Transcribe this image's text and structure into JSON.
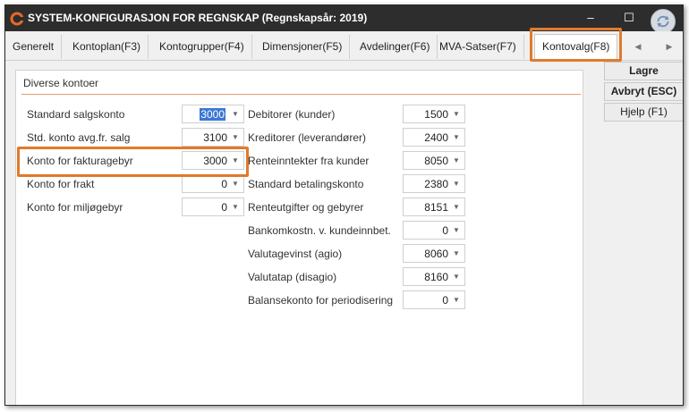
{
  "window": {
    "title": "SYSTEM-KONFIGURASJON FOR REGNSKAP  (Regnskapsår: 2019)",
    "minimize_glyph": "–",
    "maximize_glyph": "☐"
  },
  "tabs": [
    {
      "label": "Generelt"
    },
    {
      "label": "Kontoplan(F3)"
    },
    {
      "label": "Kontogrupper(F4)"
    },
    {
      "label": "Dimensjoner(F5)"
    },
    {
      "label": "Avdelinger(F6)"
    },
    {
      "label": "MVA-Satser(F7)"
    },
    {
      "label": "Kontovalg(F8)",
      "active": true
    }
  ],
  "group": {
    "title": "Diverse kontoer"
  },
  "left_fields": [
    {
      "label": "Standard salgskonto",
      "value": "3000",
      "selected": true
    },
    {
      "label": "Std. konto avg.fr. salg",
      "value": "3100"
    },
    {
      "label": "Konto for fakturagebyr",
      "value": "3000"
    },
    {
      "label": "Konto for frakt",
      "value": "0"
    },
    {
      "label": "Konto for miljøgebyr",
      "value": "0"
    }
  ],
  "right_fields": [
    {
      "label": "Debitorer  (kunder)",
      "value": "1500"
    },
    {
      "label": "Kreditorer (leverandører)",
      "value": "2400"
    },
    {
      "label": "Renteinntekter fra kunder",
      "value": "8050"
    },
    {
      "label": "Standard betalingskonto",
      "value": "2380"
    },
    {
      "label": "Renteutgifter og gebyrer",
      "value": "8151"
    },
    {
      "label": "Bankomkostn. v. kundeinnbet.",
      "value": "0"
    },
    {
      "label": "Valutagevinst (agio)",
      "value": "8060"
    },
    {
      "label": "Valutatap (disagio)",
      "value": "8160"
    },
    {
      "label": "Balansekonto for periodisering",
      "value": "0"
    }
  ],
  "side_buttons": {
    "save": "Lagre",
    "cancel": "Avbryt (ESC)",
    "help": "Hjelp (F1)"
  },
  "colors": {
    "highlight": "#e07a2b",
    "titlebar": "#2d2d2d",
    "selection": "#3a78d4"
  }
}
